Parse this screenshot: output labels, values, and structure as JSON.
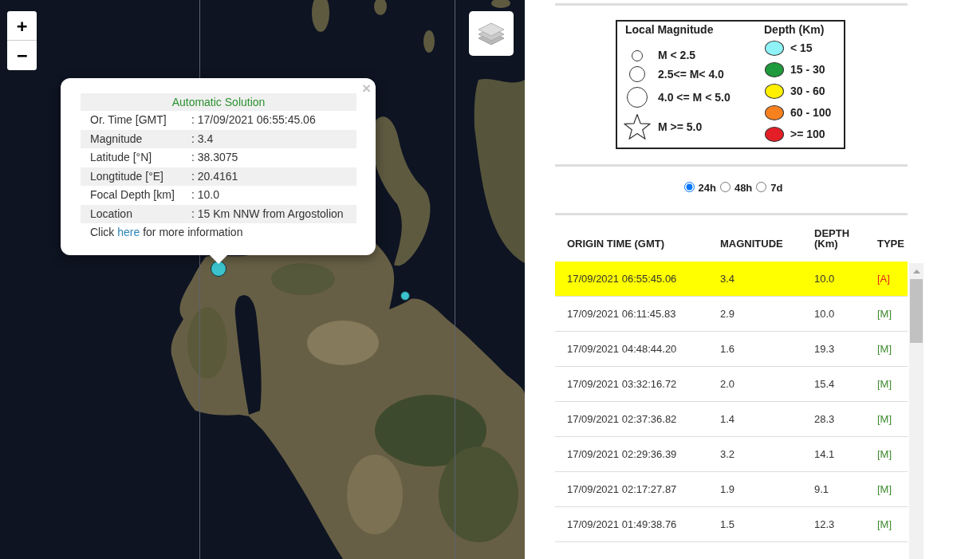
{
  "map": {
    "zoom_controls": [
      "+",
      "−"
    ],
    "markers": [
      {
        "kind": "medium",
        "color": "#3cc2cc"
      },
      {
        "kind": "small",
        "color": "#3cc2cc"
      }
    ],
    "popup": {
      "close": "×",
      "title": "Automatic Solution",
      "rows": [
        {
          "label": "Or. Time [GMT]",
          "value": ": 17/09/2021 06:55:45.06"
        },
        {
          "label": "Magnitude",
          "value": ": 3.4"
        },
        {
          "label": "Latitude [°N]",
          "value": ": 38.3075"
        },
        {
          "label": "Longtitude [°E]",
          "value": ": 20.4161"
        },
        {
          "label": "Focal Depth [km]",
          "value": ": 10.0"
        },
        {
          "label": "Location",
          "value": ": 15 Km NNW from Argostolion"
        }
      ],
      "footer": {
        "before": "Click",
        "link": "here",
        "after": "for more information"
      }
    }
  },
  "legend": {
    "magnitude": {
      "title": "Local Magnitude",
      "items": [
        {
          "kind": "small",
          "label": "M < 2.5"
        },
        {
          "kind": "medium",
          "label": "2.5<= M< 4.0"
        },
        {
          "kind": "large",
          "label": "4.0 <= M < 5.0"
        },
        {
          "kind": "star",
          "label": "M >= 5.0"
        }
      ]
    },
    "depth": {
      "title": "Depth (Km)",
      "items": [
        {
          "color": "#8ef2f7",
          "label": "< 15"
        },
        {
          "color": "#1f9a3c",
          "label": "15 - 30"
        },
        {
          "color": "#ffef00",
          "label": "30 - 60"
        },
        {
          "color": "#f7801f",
          "label": "60 - 100"
        },
        {
          "color": "#e31e26",
          "label": ">= 100"
        }
      ]
    }
  },
  "periods": [
    {
      "label": "24h",
      "selected": true
    },
    {
      "label": "48h",
      "selected": false
    },
    {
      "label": "7d",
      "selected": false
    }
  ],
  "table": {
    "columns": [
      "ORIGIN TIME (GMT)",
      "MAGNITUDE",
      "DEPTH (Km)",
      "TYPE"
    ],
    "rows": [
      {
        "origin_time": "17/09/2021 06:55:45.06",
        "magnitude": "3.4",
        "depth": "10.0",
        "type": "[A]",
        "color": "#e0251f",
        "selected": true
      },
      {
        "origin_time": "17/09/2021 06:11:45.83",
        "magnitude": "2.9",
        "depth": "10.0",
        "type": "[M]",
        "color": "#3d8a2e",
        "selected": false
      },
      {
        "origin_time": "17/09/2021 04:48:44.20",
        "magnitude": "1.6",
        "depth": "19.3",
        "type": "[M]",
        "color": "#3d8a2e",
        "selected": false
      },
      {
        "origin_time": "17/09/2021 03:32:16.72",
        "magnitude": "2.0",
        "depth": "15.4",
        "type": "[M]",
        "color": "#3d8a2e",
        "selected": false
      },
      {
        "origin_time": "17/09/2021 02:37:36.82",
        "magnitude": "1.4",
        "depth": "28.3",
        "type": "[M]",
        "color": "#3d8a2e",
        "selected": false
      },
      {
        "origin_time": "17/09/2021 02:29:36.39",
        "magnitude": "3.2",
        "depth": "14.1",
        "type": "[M]",
        "color": "#3d8a2e",
        "selected": false
      },
      {
        "origin_time": "17/09/2021 02:17:27.87",
        "magnitude": "1.9",
        "depth": "9.1",
        "type": "[M]",
        "color": "#3d8a2e",
        "selected": false
      },
      {
        "origin_time": "17/09/2021 01:49:38.76",
        "magnitude": "1.5",
        "depth": "12.3",
        "type": "[M]",
        "color": "#3d8a2e",
        "selected": false
      }
    ]
  }
}
